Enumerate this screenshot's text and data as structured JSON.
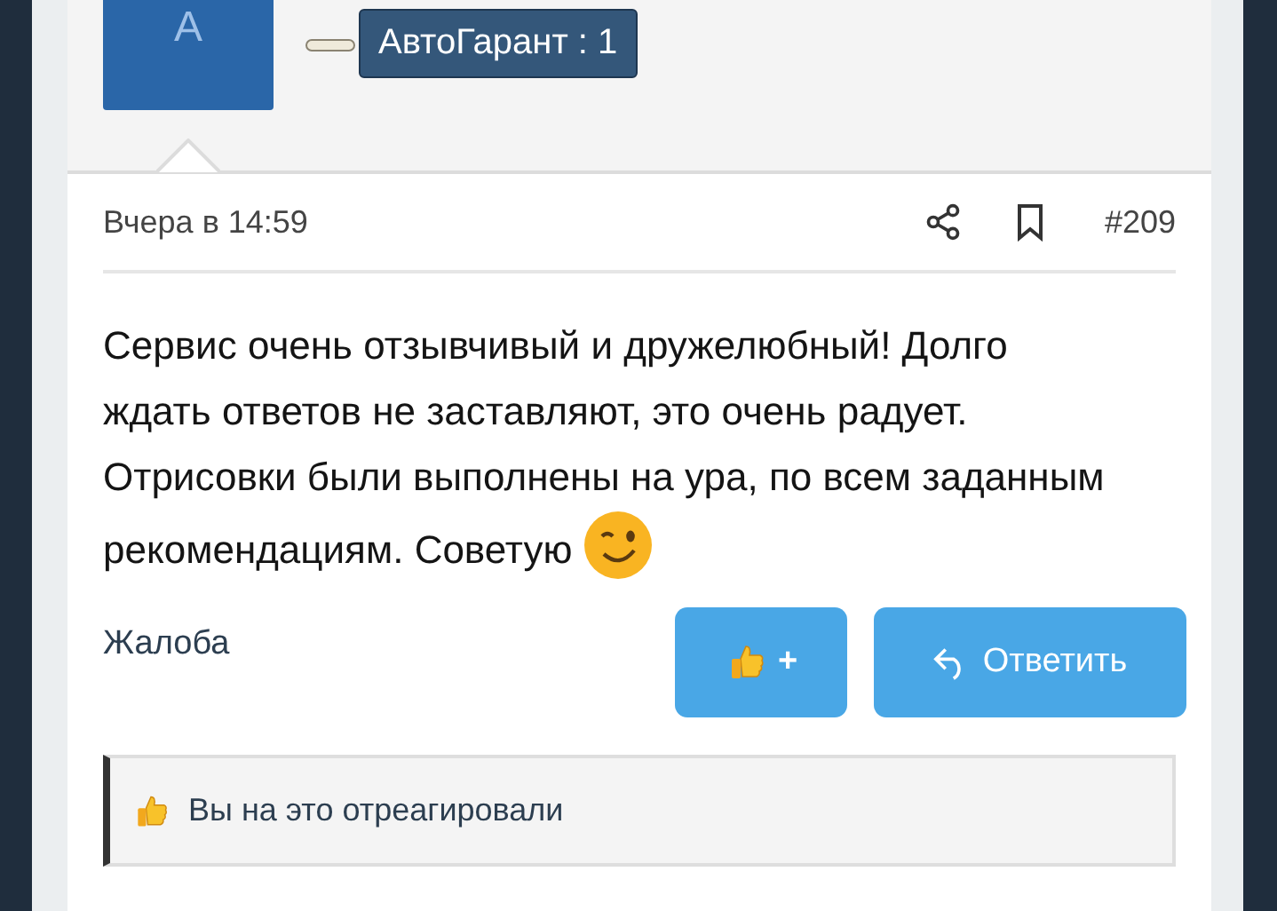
{
  "author": {
    "avatar_letter": "A",
    "badge": "АвтоГарант : 1"
  },
  "post": {
    "date": "Вчера в 14:59",
    "number": "#209",
    "body": "Сервис очень отзывчивый и дружелюбный! Долго ждать ответов не заставляют, это очень радует. Отрисовки были выполнены на ура, по всем заданным рекомендациям. Советую"
  },
  "actions": {
    "report": "Жалоба",
    "like": "+",
    "reply": "Ответить"
  },
  "reaction": {
    "text": "Вы на это отреагировали"
  }
}
